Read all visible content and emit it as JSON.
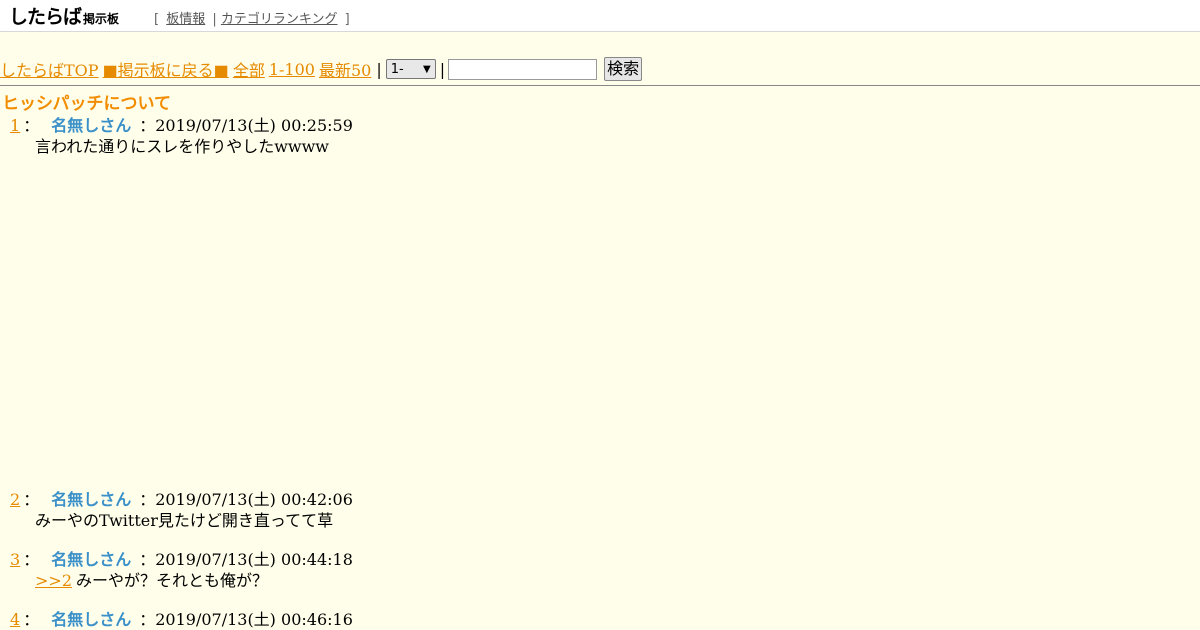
{
  "header": {
    "logo_main": "したらば",
    "logo_sub": "掲示板",
    "nav_open": "[",
    "nav_board_info": "板情報",
    "nav_sep": "|",
    "nav_category_ranking": "カテゴリランキング",
    "nav_close": "]"
  },
  "nav": {
    "top_link": "したらばTOP",
    "back_link": "■掲示板に戻る■",
    "all_link": "全部",
    "range_link": "1-100",
    "latest_link": "最新50",
    "sep": "|",
    "select_value": "1-",
    "search_value": "",
    "search_button": "検索"
  },
  "thread": {
    "title": "ヒッシパッチについて"
  },
  "posts": [
    {
      "num": "1",
      "colon": "：",
      "name": "名無しさん",
      "date": "：2019/07/13(土) 00:25:59",
      "anchor": "",
      "body": "言われた通りにスレを作りやしたwwww"
    },
    {
      "num": "2",
      "colon": "：",
      "name": "名無しさん",
      "date": "：2019/07/13(土) 00:42:06",
      "anchor": "",
      "body": "みーやのTwitter見たけど開き直ってて草"
    },
    {
      "num": "3",
      "colon": "：",
      "name": "名無しさん",
      "date": "：2019/07/13(土) 00:44:18",
      "anchor": ">>2",
      "body": "みーやが？それとも俺が？"
    },
    {
      "num": "4",
      "colon": "：",
      "name": "名無しさん",
      "date": "：2019/07/13(土) 00:46:16",
      "anchor": "",
      "body": ""
    }
  ],
  "colors": {
    "background": "#fffeea",
    "link": "#e68a00",
    "title": "#f28c00",
    "name": "#3a90c8"
  }
}
